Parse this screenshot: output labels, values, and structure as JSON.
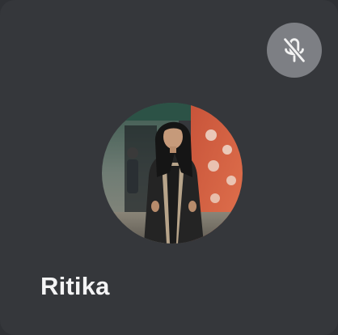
{
  "participant": {
    "name": "Ritika",
    "mic_status_icon": "microphone-muted-icon",
    "avatar_icon": "participant-photo"
  },
  "colors": {
    "tile_background": "#35373b",
    "mute_badge": "#7d7f84",
    "name_text": "#f4f4f5"
  }
}
